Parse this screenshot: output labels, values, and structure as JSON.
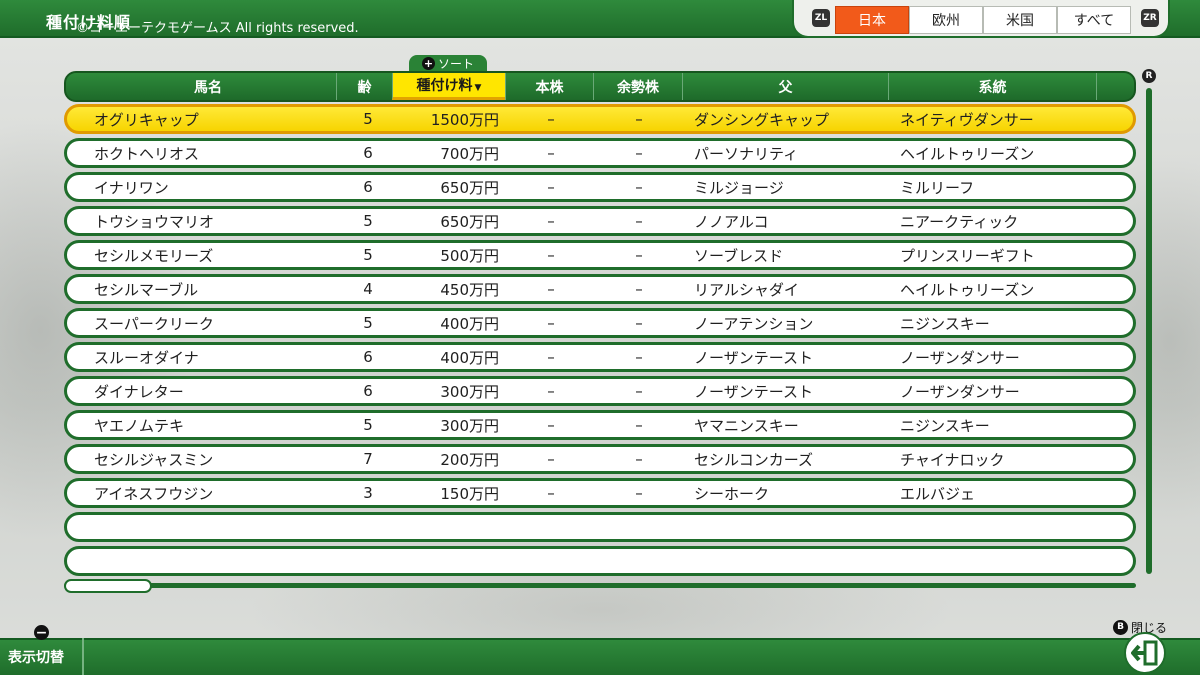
{
  "header": {
    "title": "種付け料順",
    "copyright": "©コーエーテクモゲームス All rights reserved."
  },
  "region_tabs": {
    "left_button": "ZL",
    "right_button": "ZR",
    "items": [
      {
        "label": "日本",
        "active": true
      },
      {
        "label": "欧州",
        "active": false
      },
      {
        "label": "米国",
        "active": false
      },
      {
        "label": "すべて",
        "active": false
      }
    ]
  },
  "sort_hint": {
    "label": "ソート",
    "icon": "plus-icon"
  },
  "columns": {
    "name": "馬名",
    "age": "齢",
    "fee": "種付け料",
    "fee_sort_arrow": "▼",
    "stock": "本株",
    "surplus": "余勢株",
    "sire": "父",
    "line": "系統"
  },
  "rows": [
    {
      "name": "オグリキャップ",
      "age": "5",
      "fee": "1500万円",
      "stock": "–",
      "surplus": "–",
      "sire": "ダンシングキャップ",
      "line": "ネイティヴダンサー"
    },
    {
      "name": "ホクトヘリオス",
      "age": "6",
      "fee": "700万円",
      "stock": "–",
      "surplus": "–",
      "sire": "パーソナリティ",
      "line": "ヘイルトゥリーズン"
    },
    {
      "name": "イナリワン",
      "age": "6",
      "fee": "650万円",
      "stock": "–",
      "surplus": "–",
      "sire": "ミルジョージ",
      "line": "ミルリーフ"
    },
    {
      "name": "トウショウマリオ",
      "age": "5",
      "fee": "650万円",
      "stock": "–",
      "surplus": "–",
      "sire": "ノノアルコ",
      "line": "ニアークティック"
    },
    {
      "name": "セシルメモリーズ",
      "age": "5",
      "fee": "500万円",
      "stock": "–",
      "surplus": "–",
      "sire": "ソーブレスド",
      "line": "プリンスリーギフト"
    },
    {
      "name": "セシルマーブル",
      "age": "4",
      "fee": "450万円",
      "stock": "–",
      "surplus": "–",
      "sire": "リアルシャダイ",
      "line": "ヘイルトゥリーズン"
    },
    {
      "name": "スーパークリーク",
      "age": "5",
      "fee": "400万円",
      "stock": "–",
      "surplus": "–",
      "sire": "ノーアテンション",
      "line": "ニジンスキー"
    },
    {
      "name": "スルーオダイナ",
      "age": "6",
      "fee": "400万円",
      "stock": "–",
      "surplus": "–",
      "sire": "ノーザンテースト",
      "line": "ノーザンダンサー"
    },
    {
      "name": "ダイナレター",
      "age": "6",
      "fee": "300万円",
      "stock": "–",
      "surplus": "–",
      "sire": "ノーザンテースト",
      "line": "ノーザンダンサー"
    },
    {
      "name": "ヤエノムテキ",
      "age": "5",
      "fee": "300万円",
      "stock": "–",
      "surplus": "–",
      "sire": "ヤマニンスキー",
      "line": "ニジンスキー"
    },
    {
      "name": "セシルジャスミン",
      "age": "7",
      "fee": "200万円",
      "stock": "–",
      "surplus": "–",
      "sire": "セシルコンカーズ",
      "line": "チャイナロック"
    },
    {
      "name": "アイネスフウジン",
      "age": "3",
      "fee": "150万円",
      "stock": "–",
      "surplus": "–",
      "sire": "シーホーク",
      "line": "エルバジェ"
    }
  ],
  "scroll": {
    "vertical_button": "R"
  },
  "footer": {
    "toggle_label": "表示切替",
    "close_label": "閉じる",
    "close_button": "B"
  },
  "colors": {
    "accent_green": "#1f6d2b",
    "selected_row": "#ffe600",
    "active_tab": "#f25a1a"
  }
}
